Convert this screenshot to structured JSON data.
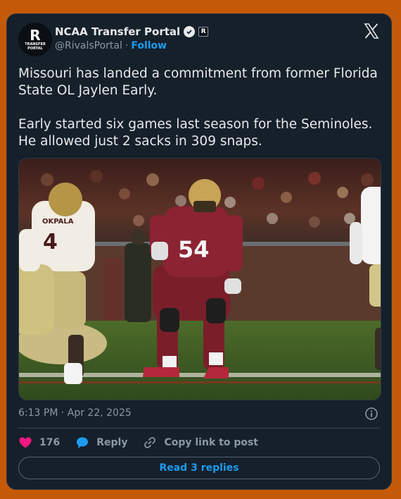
{
  "author": {
    "avatar_big": "R",
    "avatar_small": "TRANSFER\nPORTAL",
    "display_name": "NCAA Transfer Portal",
    "affiliate_badge": "R",
    "handle": "@RivalsPortal",
    "separator": "·",
    "follow_label": "Follow"
  },
  "tweet": {
    "text": "Missouri has landed a commitment from former Florida State OL Jaylen Early.\n\nEarly started six games last season for the Seminoles. He allowed just 2 sacks in 309 snaps.",
    "timestamp": "6:13 PM · Apr 22, 2025"
  },
  "photo": {
    "jersey_left_name": "OKPALA",
    "jersey_left_number": "4",
    "jersey_center_number": "54"
  },
  "actions": {
    "likes": "176",
    "reply_label": "Reply",
    "copy_label": "Copy link to post"
  },
  "replies_button": "Read 3 replies",
  "colors": {
    "page_background": "#c45a08",
    "card_background": "#15202b",
    "accent_blue": "#1d9bf0",
    "like_pink": "#f91880"
  }
}
